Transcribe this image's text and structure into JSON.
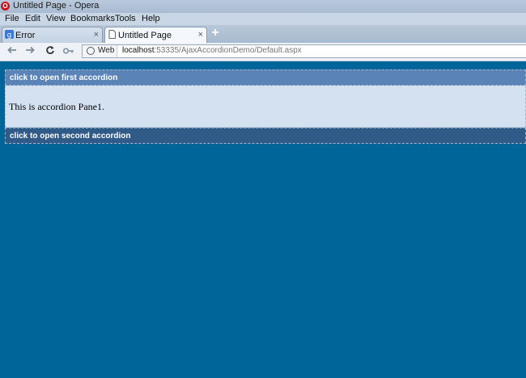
{
  "window": {
    "title": "Untitled Page - Opera"
  },
  "menu": {
    "items": [
      "File",
      "Edit",
      "View",
      "Bookmarks",
      "Tools",
      "Help"
    ]
  },
  "tabs": [
    {
      "label": "Error",
      "close": "×",
      "active": false
    },
    {
      "label": "Untitled Page",
      "close": "×",
      "active": true
    }
  ],
  "newtab": "+",
  "address": {
    "web_label": "Web",
    "host": "localhost",
    "path": ":53335/AjaxAccordionDemo/Default.aspx"
  },
  "accordion": {
    "first_header": "click to open first accordion",
    "pane1_text": "This is accordion Pane1.",
    "second_header": "click to open second accordion"
  },
  "colors": {
    "page_background": "#006699",
    "header_first": "#5a84b8",
    "header_second": "#305a87",
    "pane_background": "#d4e1f0"
  }
}
